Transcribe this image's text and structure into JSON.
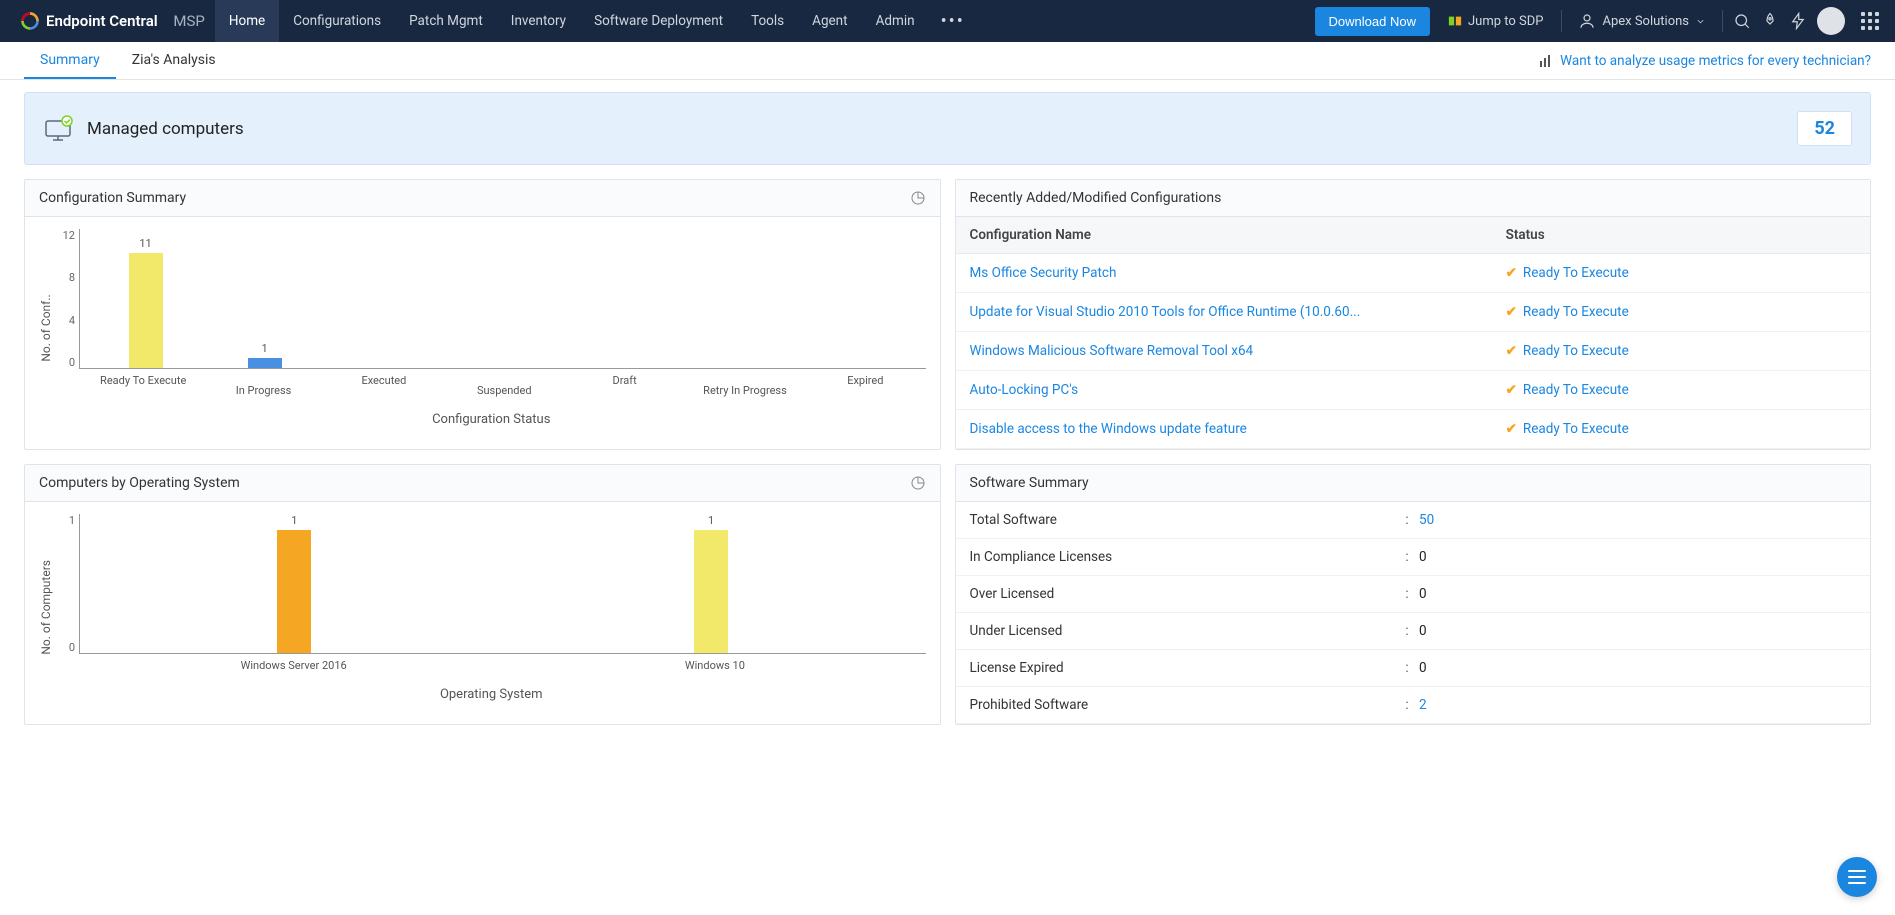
{
  "brand": {
    "name": "Endpoint Central",
    "suffix": "MSP"
  },
  "nav": [
    "Home",
    "Configurations",
    "Patch Mgmt",
    "Inventory",
    "Software Deployment",
    "Tools",
    "Agent",
    "Admin"
  ],
  "nav_active": 0,
  "download_label": "Download Now",
  "jump_label": "Jump to SDP",
  "org_name": "Apex Solutions",
  "tabs": [
    {
      "label": "Summary",
      "active": true
    },
    {
      "label": "Zia's Analysis",
      "active": false
    }
  ],
  "analyze_hint": "Want to analyze usage metrics for every technician?",
  "hero": {
    "title": "Managed computers",
    "count": "52"
  },
  "config_panel_title": "Configuration Summary",
  "chart_data": [
    {
      "type": "bar",
      "title": "Configuration Summary",
      "xlabel": "Configuration Status",
      "ylabel": "No. of Conf..",
      "yticks": [
        12,
        8,
        4,
        0
      ],
      "ylim": [
        0,
        12
      ],
      "categories": [
        "Ready To Execute",
        "In Progress",
        "Executed",
        "Suspended",
        "Draft",
        "Retry In Progress",
        "Expired"
      ],
      "values": [
        11,
        1,
        0,
        0,
        0,
        0,
        0
      ],
      "colors": [
        "#f2e96b",
        "#4a90e2",
        "#999",
        "#999",
        "#999",
        "#999",
        "#999"
      ]
    },
    {
      "type": "bar",
      "title": "Computers by Operating System",
      "xlabel": "Operating System",
      "ylabel": "No. of Computers",
      "yticks": [
        1,
        0
      ],
      "ylim": [
        0,
        1
      ],
      "categories": [
        "Windows Server 2016",
        "Windows 10"
      ],
      "values": [
        1,
        1
      ],
      "colors": [
        "#f5a623",
        "#f2e96b"
      ]
    }
  ],
  "os_panel_title": "Computers by Operating System",
  "recent_panel_title": "Recently Added/Modified Configurations",
  "recent_headers": {
    "name": "Configuration Name",
    "status": "Status"
  },
  "recent_rows": [
    {
      "name": "Ms Office Security Patch",
      "status": "Ready To Execute"
    },
    {
      "name": "Update for Visual Studio 2010 Tools for Office Runtime (10.0.60...",
      "status": "Ready To Execute"
    },
    {
      "name": "Windows Malicious Software Removal Tool x64",
      "status": "Ready To Execute"
    },
    {
      "name": "Auto-Locking PC's",
      "status": "Ready To Execute"
    },
    {
      "name": "Disable access to the Windows update feature",
      "status": "Ready To Execute"
    }
  ],
  "software_panel_title": "Software Summary",
  "software_rows": [
    {
      "label": "Total Software",
      "value": "50",
      "link": true
    },
    {
      "label": "In Compliance Licenses",
      "value": "0",
      "link": false
    },
    {
      "label": "Over Licensed",
      "value": "0",
      "link": false
    },
    {
      "label": "Under Licensed",
      "value": "0",
      "link": false
    },
    {
      "label": "License Expired",
      "value": "0",
      "link": false
    },
    {
      "label": "Prohibited Software",
      "value": "2",
      "link": true
    }
  ]
}
